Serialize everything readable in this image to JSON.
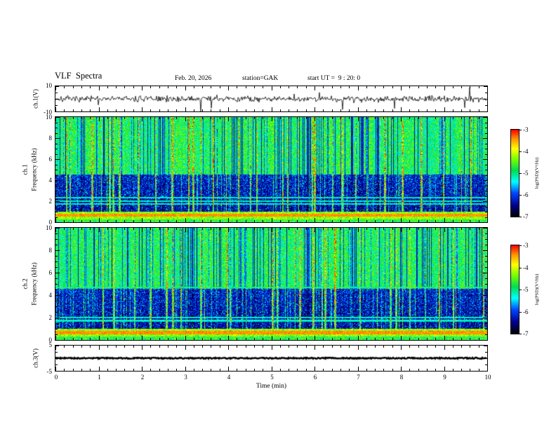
{
  "header": {
    "title": "VLF  Spectra",
    "date": "Feb. 20, 2026",
    "station": "station=GAK",
    "start_ut": "start UT =  9 : 20: 0"
  },
  "axes": {
    "time_label": "Time (min)",
    "time_ticks": [
      "0",
      "1",
      "2",
      "3",
      "4",
      "5",
      "6",
      "7",
      "8",
      "9",
      "10"
    ],
    "freq_ticks": [
      "10",
      "8",
      "6",
      "4",
      "2",
      "0"
    ],
    "wave_ymax": "10",
    "wave_ymin": "-10",
    "ch3_ymax": "5",
    "ch3_ymin": "-5"
  },
  "panels": {
    "wave": {
      "label": "ch.1(V)"
    },
    "spec1": {
      "channel": "ch.1",
      "ylabel": "Frequency (kHz)"
    },
    "spec2": {
      "channel": "ch.2",
      "ylabel": "Frequency (kHz)"
    },
    "ch3": {
      "label": "ch.3(V)"
    }
  },
  "colorbar": {
    "label": "log(PSD)(V²/Hz)",
    "ticks": [
      "-3",
      "-4",
      "-5",
      "-6",
      "-7"
    ]
  },
  "chart_data": {
    "type": "heatmap",
    "title": "VLF  Spectra",
    "x": {
      "label": "Time (min)",
      "range": [
        0,
        10
      ],
      "major_tick": 1,
      "station": "GAK",
      "date": "Feb. 20, 2026",
      "start_ut": "9:20:0"
    },
    "subplots": [
      {
        "name": "ch.1 time series",
        "type": "line",
        "ylabel": "ch.1(V)",
        "ylim": [
          -10,
          10
        ],
        "description": "broadband noise of about ±2 V with frequent impulsive spikes reaching ±9 V over the whole 10-minute record"
      },
      {
        "name": "ch.1 spectrogram",
        "type": "heatmap",
        "ylabel": "Frequency (kHz)",
        "ylim": [
          0,
          10
        ],
        "zlabel": "log(PSD)(V²/Hz)",
        "zlim": [
          -7,
          -3
        ],
        "features": {
          "intense_band_kHz": [
            0.3,
            1.0
          ],
          "intense_band_level": -3.3,
          "quiet_band_kHz": [
            1.0,
            4.6
          ],
          "quiet_band_level": -6.6,
          "diffuse_band_kHz": [
            4.6,
            10.0
          ],
          "diffuse_band_level": -5.2,
          "vertical_streaks": "impulsive broadband streaks up to -3 occurring every few seconds",
          "horizontal_lines_kHz": [
            1.75,
            2.05,
            2.35
          ]
        }
      },
      {
        "name": "ch.2 spectrogram",
        "type": "heatmap",
        "ylabel": "Frequency (kHz)",
        "ylim": [
          0,
          10
        ],
        "zlabel": "log(PSD)(V²/Hz)",
        "zlim": [
          -7,
          -3
        ],
        "features": {
          "intense_band_kHz": [
            0.3,
            1.0
          ],
          "intense_band_level": -3.3,
          "quiet_band_kHz": [
            1.0,
            4.6
          ],
          "quiet_band_level": -6.6,
          "diffuse_band_kHz": [
            4.6,
            10.0
          ],
          "diffuse_band_level": -5.2,
          "vertical_streaks": "impulsive broadband streaks up to -3 occurring every few seconds",
          "horizontal_lines_kHz": [
            1.75,
            2.05,
            4.7
          ]
        }
      },
      {
        "name": "ch.3 time series",
        "type": "line",
        "ylabel": "ch.3(V)",
        "ylim": [
          -5,
          5
        ],
        "description": "flat trace pinned near 0 V for the entire record"
      }
    ],
    "render": {
      "seeds": {
        "wave": 7,
        "spec1": 101,
        "spec2": 202,
        "ch3": 9
      },
      "streak_prob": 0.055,
      "top_dark_prob": 0.2,
      "colormap_hex": [
        "#000000",
        "#00008c",
        "#0046ff",
        "#00ffff",
        "#00dc50",
        "#78ff00",
        "#ffff00",
        "#ff9600",
        "#ff0000"
      ]
    }
  }
}
